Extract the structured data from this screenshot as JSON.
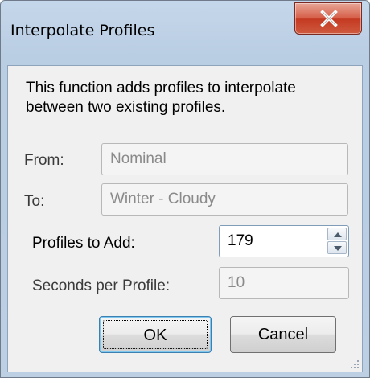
{
  "window": {
    "title": "Interpolate Profiles",
    "description": "This function adds profiles to interpolate between two existing profiles."
  },
  "form": {
    "from_label": "From:",
    "from_value": "Nominal",
    "to_label": "To:",
    "to_value": "Winter - Cloudy",
    "profiles_label": "Profiles to Add:",
    "profiles_value": "179",
    "seconds_label": "Seconds per Profile:",
    "seconds_value": "10"
  },
  "buttons": {
    "ok_label": "OK",
    "cancel_label": "Cancel"
  },
  "icons": {
    "close": "close-x-icon",
    "spin_up": "arrow-up-icon",
    "spin_down": "arrow-down-icon",
    "resize": "resize-grip-icon"
  },
  "colors": {
    "title_bar": "#c5d7ea",
    "close_button": "#c43a22",
    "client_background": "#f0f0f0",
    "default_button_border": "#3c7fb1"
  }
}
